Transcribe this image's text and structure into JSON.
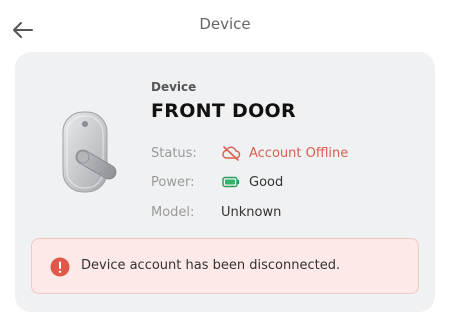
{
  "header": {
    "title": "Device",
    "back_icon": "arrow-left-icon"
  },
  "device": {
    "label": "Device",
    "name": "FRONT DOOR",
    "image": "smart-lock-image"
  },
  "info": {
    "status": {
      "label": "Status:",
      "value": "Account Offline",
      "icon": "cloud-offline-icon",
      "color": "#d9604f"
    },
    "power": {
      "label": "Power:",
      "value": "Good",
      "icon": "battery-icon",
      "color": "#34b46b"
    },
    "model": {
      "label": "Model:",
      "value": "Unknown"
    }
  },
  "alert": {
    "icon": "error-icon",
    "text": "Device account has been disconnected.",
    "color": "#e0584c"
  }
}
